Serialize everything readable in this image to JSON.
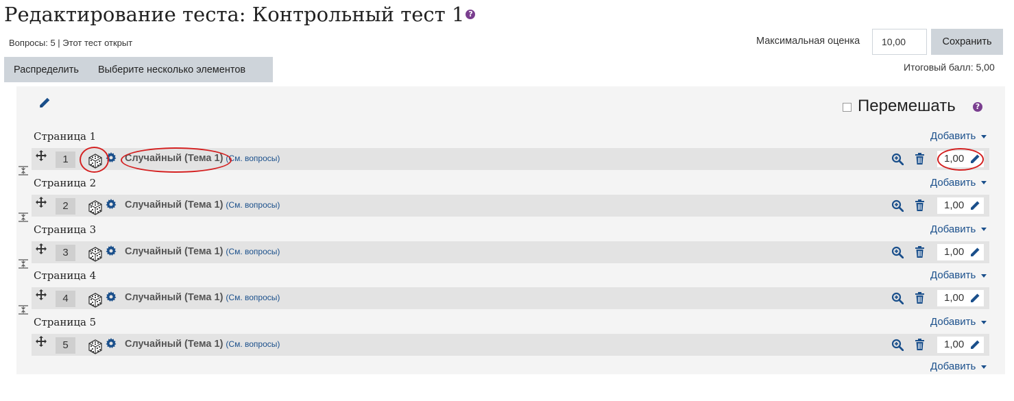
{
  "header": {
    "title": "Редактирование теста: Контрольный тест 1",
    "help_glyph": "?",
    "status": "Вопросы: 5 | Этот тест открыт"
  },
  "toolbar": {
    "repaginate_label": "Распределить",
    "select_multiple_label": "Выберите несколько элементов"
  },
  "grade": {
    "max_label": "Максимальная оценка",
    "max_value": "10,00",
    "save_label": "Сохранить",
    "total": "Итоговый балл: 5,00"
  },
  "section": {
    "shuffle_label": "Перемешать",
    "shuffle_checked": false,
    "add_label": "Добавить"
  },
  "pages": [
    {
      "label": "Страница 1",
      "slot": {
        "number": "1",
        "name": "Случайный (Тема 1)",
        "see_link": "(См. вопросы)",
        "mark": "1,00"
      }
    },
    {
      "label": "Страница 2",
      "slot": {
        "number": "2",
        "name": "Случайный (Тема 1)",
        "see_link": "(См. вопросы)",
        "mark": "1,00"
      }
    },
    {
      "label": "Страница 3",
      "slot": {
        "number": "3",
        "name": "Случайный (Тема 1)",
        "see_link": "(См. вопросы)",
        "mark": "1,00"
      }
    },
    {
      "label": "Страница 4",
      "slot": {
        "number": "4",
        "name": "Случайный (Тема 1)",
        "see_link": "(См. вопросы)",
        "mark": "1,00"
      }
    },
    {
      "label": "Страница 5",
      "slot": {
        "number": "5",
        "name": "Случайный (Тема 1)",
        "see_link": "(См. вопросы)",
        "mark": "1,00"
      }
    }
  ],
  "colors": {
    "link": "#1a4f8b",
    "help": "#7a3e8f",
    "annotation": "#d42020",
    "slot_bg": "#e3e3e3",
    "section_bg": "#f4f4f4"
  },
  "icons": [
    "help-icon",
    "edit-pencil-icon",
    "move-icon",
    "random-dice-icon",
    "gear-icon",
    "preview-zoom-icon",
    "trash-icon",
    "page-break-icon",
    "caret-down-icon"
  ]
}
